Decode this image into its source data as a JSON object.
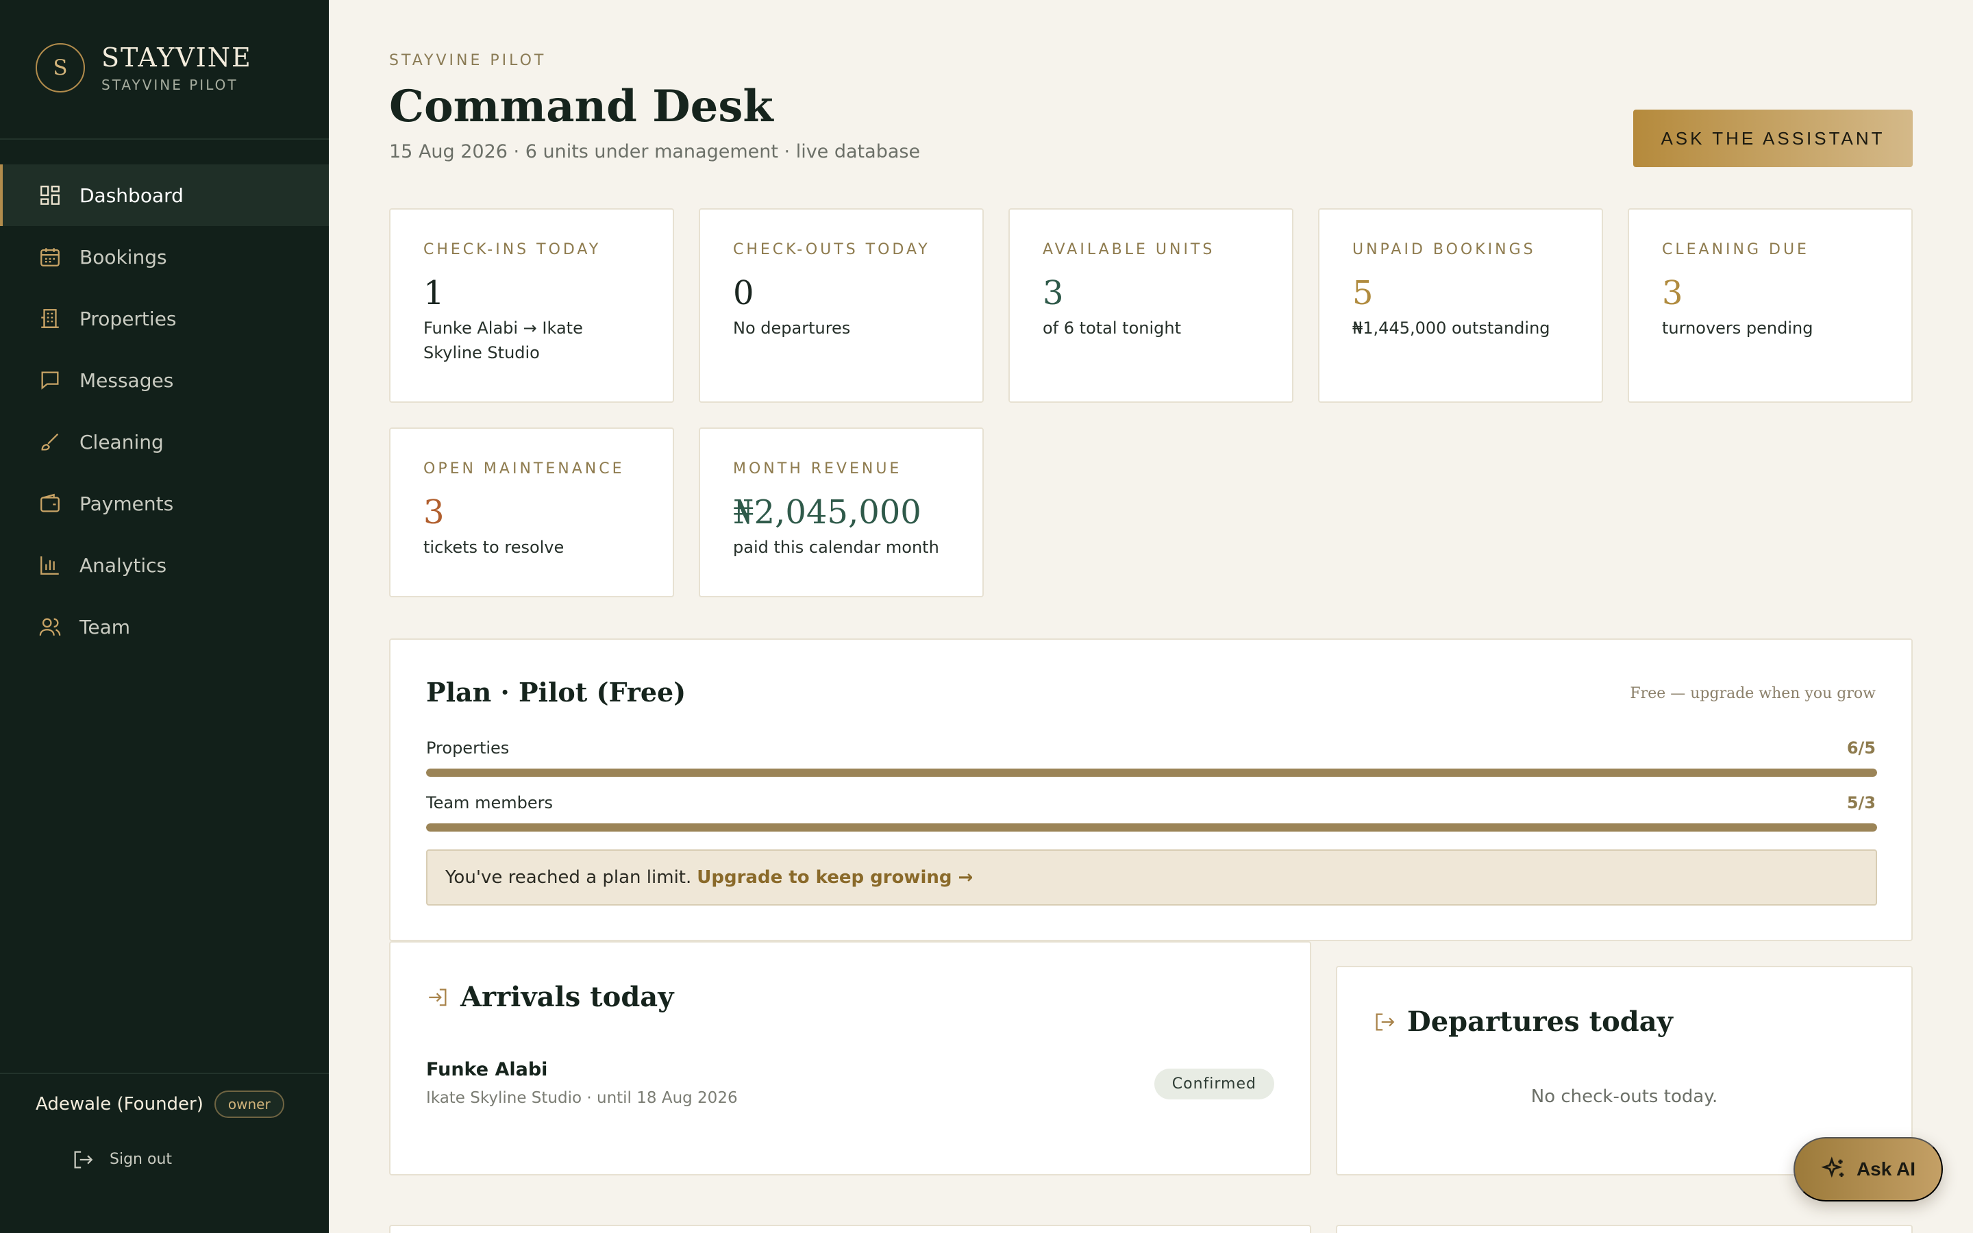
{
  "brand": {
    "mark": "S",
    "name": "STAYVINE",
    "subtitle": "STAYVINE PILOT"
  },
  "sidebar": {
    "items": [
      {
        "label": "Dashboard",
        "icon": "dashboard-icon",
        "active": true
      },
      {
        "label": "Bookings",
        "icon": "calendar-icon"
      },
      {
        "label": "Properties",
        "icon": "building-icon"
      },
      {
        "label": "Messages",
        "icon": "message-icon"
      },
      {
        "label": "Cleaning",
        "icon": "brush-icon"
      },
      {
        "label": "Payments",
        "icon": "wallet-icon"
      },
      {
        "label": "Analytics",
        "icon": "bar-chart-icon"
      },
      {
        "label": "Team",
        "icon": "users-icon"
      }
    ],
    "user": {
      "name": "Adewale (Founder)",
      "role": "owner"
    },
    "signout_label": "Sign out"
  },
  "header": {
    "eyebrow": "STAYVINE PILOT",
    "title": "Command Desk",
    "subtitle": "15 Aug 2026 · 6 units under management · live database",
    "assistant_button": "ASK THE ASSISTANT"
  },
  "stats": [
    {
      "label": "CHECK-INS TODAY",
      "value": "1",
      "desc": "Funke Alabi → Ikate Skyline Studio",
      "tone": "dark"
    },
    {
      "label": "CHECK-OUTS TODAY",
      "value": "0",
      "desc": "No departures",
      "tone": "dark"
    },
    {
      "label": "AVAILABLE UNITS",
      "value": "3",
      "desc": "of 6 total tonight",
      "tone": "green"
    },
    {
      "label": "UNPAID BOOKINGS",
      "value": "5",
      "desc": "₦1,445,000 outstanding",
      "tone": "gold"
    },
    {
      "label": "CLEANING DUE",
      "value": "3",
      "desc": "turnovers pending",
      "tone": "gold"
    },
    {
      "label": "OPEN MAINTENANCE",
      "value": "3",
      "desc": "tickets to resolve",
      "tone": "rust"
    },
    {
      "label": "MONTH REVENUE",
      "value": "₦2,045,000",
      "desc": "paid this calendar month",
      "tone": "green"
    }
  ],
  "plan": {
    "title": "Plan · Pilot (Free)",
    "note": "Free — upgrade when you grow",
    "meters": [
      {
        "label": "Properties",
        "value": "6/5",
        "fill": 1.0
      },
      {
        "label": "Team members",
        "value": "5/3",
        "fill": 1.0
      }
    ],
    "banner_text": "You've reached a plan limit.",
    "banner_link": "Upgrade to keep growing →"
  },
  "arrivals": {
    "title": "Arrivals today",
    "items": [
      {
        "name": "Funke Alabi",
        "meta": "Ikate Skyline Studio · until 18 Aug 2026",
        "status": "Confirmed"
      }
    ]
  },
  "departures": {
    "title": "Departures today",
    "empty": "No check-outs today."
  },
  "ask_ai": {
    "label": "Ask AI"
  },
  "colors": {
    "sidebar": "#12201a",
    "accent": "#b28c4c",
    "background": "#f6f3ec"
  }
}
